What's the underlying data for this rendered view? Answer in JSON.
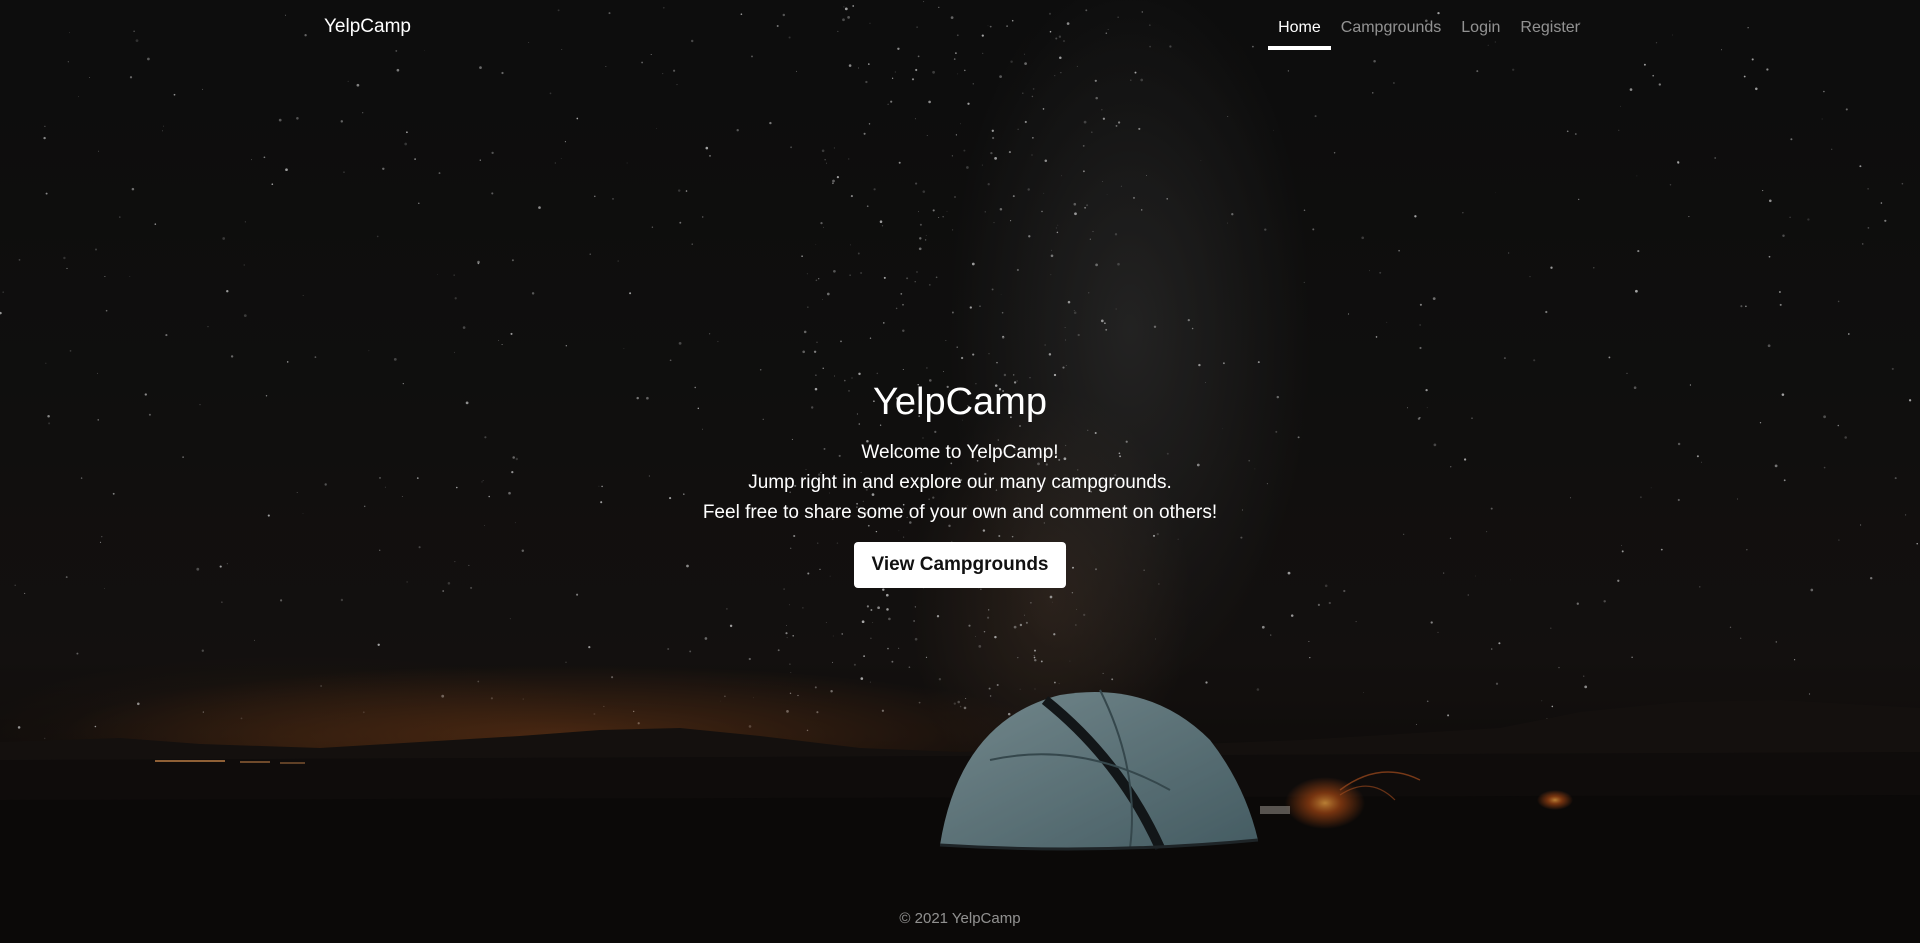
{
  "nav": {
    "brand": "YelpCamp",
    "links": [
      {
        "label": "Home",
        "active": true
      },
      {
        "label": "Campgrounds",
        "active": false
      },
      {
        "label": "Login",
        "active": false
      },
      {
        "label": "Register",
        "active": false
      }
    ]
  },
  "hero": {
    "title": "YelpCamp",
    "lines": [
      "Welcome to YelpCamp!",
      "Jump right in and explore our many campgrounds.",
      "Feel free to share some of your own and comment on others!"
    ],
    "button_label": "View Campgrounds",
    "background_image": "starry-night-tent-photo"
  },
  "footer": {
    "text": "© 2021 YelpCamp"
  },
  "colors": {
    "text": "#ffffff",
    "muted_text": "#8c8c8c",
    "button_bg": "#ffffff",
    "button_text": "#111111"
  }
}
